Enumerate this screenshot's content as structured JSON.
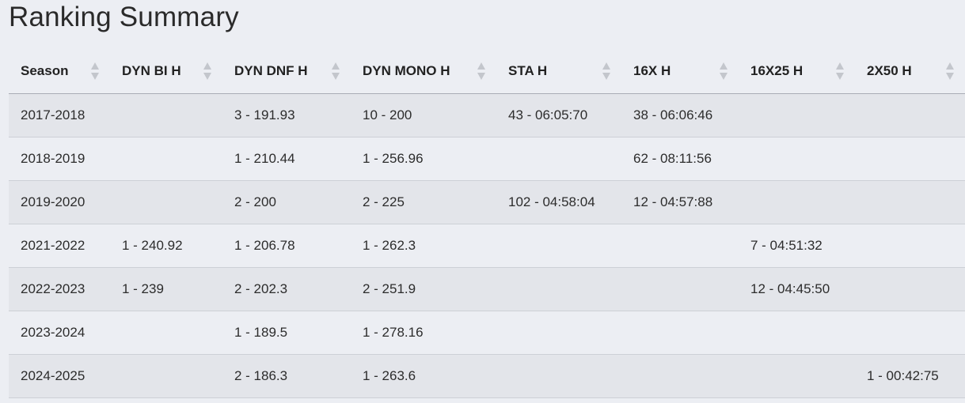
{
  "page": {
    "title": "Ranking Summary"
  },
  "table": {
    "columns": [
      {
        "key": "season",
        "label": "Season",
        "sort_icon": "sort-icon"
      },
      {
        "key": "dyn_bi_h",
        "label": "DYN BI H",
        "sort_icon": "sort-icon"
      },
      {
        "key": "dyn_dnf_h",
        "label": "DYN DNF H",
        "sort_icon": "sort-icon"
      },
      {
        "key": "dyn_mono_h",
        "label": "DYN MONO H",
        "sort_icon": "sort-icon"
      },
      {
        "key": "sta_h",
        "label": "STA H",
        "sort_icon": "sort-icon"
      },
      {
        "key": "16x_h",
        "label": "16X H",
        "sort_icon": "sort-icon"
      },
      {
        "key": "16x25_h",
        "label": "16X25 H",
        "sort_icon": "sort-icon"
      },
      {
        "key": "2x50_h",
        "label": "2X50 H",
        "sort_icon": "sort-icon"
      }
    ],
    "rows": [
      [
        "2017-2018",
        "",
        "3 - 191.93",
        "10 - 200",
        "43 - 06:05:70",
        "38 - 06:06:46",
        "",
        ""
      ],
      [
        "2018-2019",
        "",
        "1 - 210.44",
        "1 - 256.96",
        "",
        "62 - 08:11:56",
        "",
        ""
      ],
      [
        "2019-2020",
        "",
        "2 - 200",
        "2 - 225",
        "102 - 04:58:04",
        "12 - 04:57:88",
        "",
        ""
      ],
      [
        "2021-2022",
        "1 - 240.92",
        "1 - 206.78",
        "1 - 262.3",
        "",
        "",
        "7 - 04:51:32",
        ""
      ],
      [
        "2022-2023",
        "1 - 239",
        "2 - 202.3",
        "2 - 251.9",
        "",
        "",
        "12 - 04:45:50",
        ""
      ],
      [
        "2023-2024",
        "",
        "1 - 189.5",
        "1 - 278.16",
        "",
        "",
        "",
        ""
      ],
      [
        "2024-2025",
        "",
        "2 - 186.3",
        "1 - 263.6",
        "",
        "",
        "",
        "1 - 00:42:75"
      ]
    ]
  }
}
